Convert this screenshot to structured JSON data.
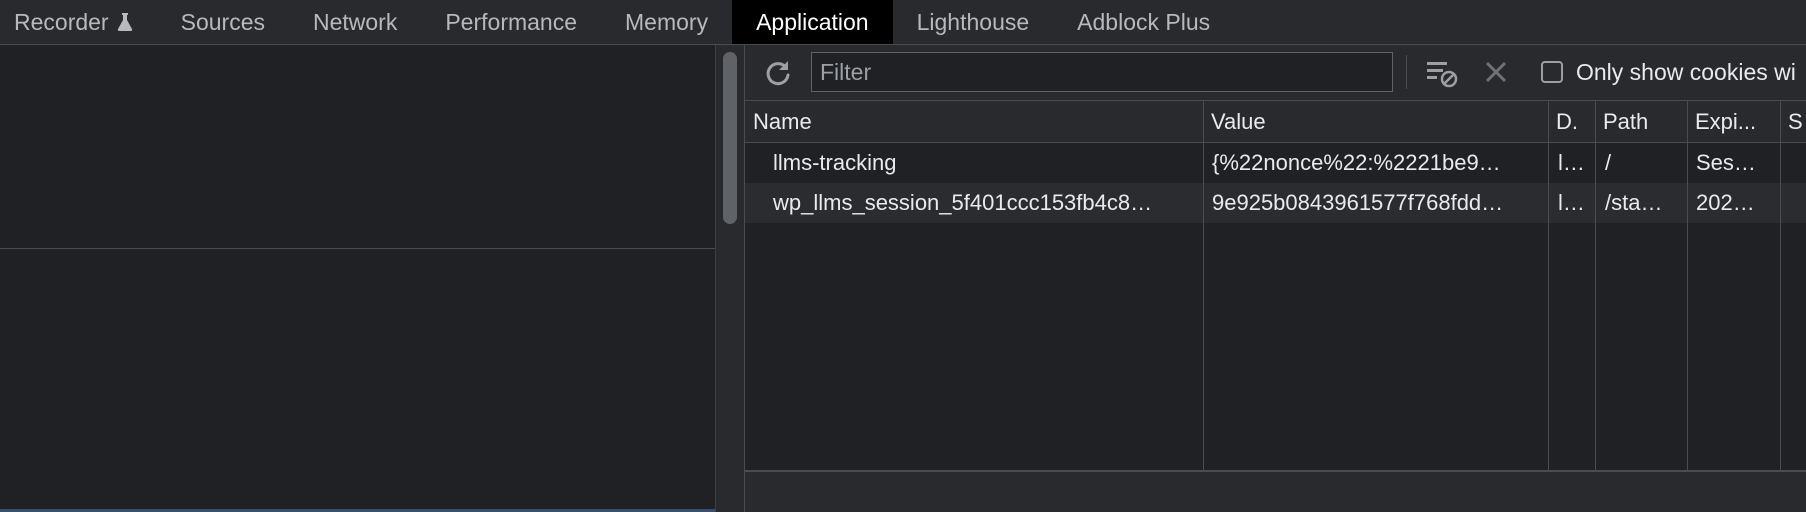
{
  "tabs": [
    {
      "label": "Recorder",
      "active": false
    },
    {
      "label": "Sources",
      "active": false
    },
    {
      "label": "Network",
      "active": false
    },
    {
      "label": "Performance",
      "active": false
    },
    {
      "label": "Memory",
      "active": false
    },
    {
      "label": "Application",
      "active": true
    },
    {
      "label": "Lighthouse",
      "active": false
    },
    {
      "label": "Adblock Plus",
      "active": false
    }
  ],
  "toolbar": {
    "filter_placeholder": "Filter",
    "only_show_label": "Only show cookies wi"
  },
  "table": {
    "columns": [
      "Name",
      "Value",
      "D.",
      "Path",
      "Expi...",
      "S"
    ],
    "rows": [
      {
        "name": "llms-tracking",
        "value": "{%22nonce%22:%2221be9…",
        "domain": "l…",
        "path": "/",
        "expires": "Ses…"
      },
      {
        "name": "wp_llms_session_5f401ccc153fb4c8…",
        "value": "9e925b0843961577f768fdd…",
        "domain": "l…",
        "path": "/sta…",
        "expires": "202…"
      }
    ]
  },
  "colors": {
    "background": "#202124",
    "toolbar": "#292a2d",
    "active_tab": "#000000",
    "border": "#494c50"
  }
}
